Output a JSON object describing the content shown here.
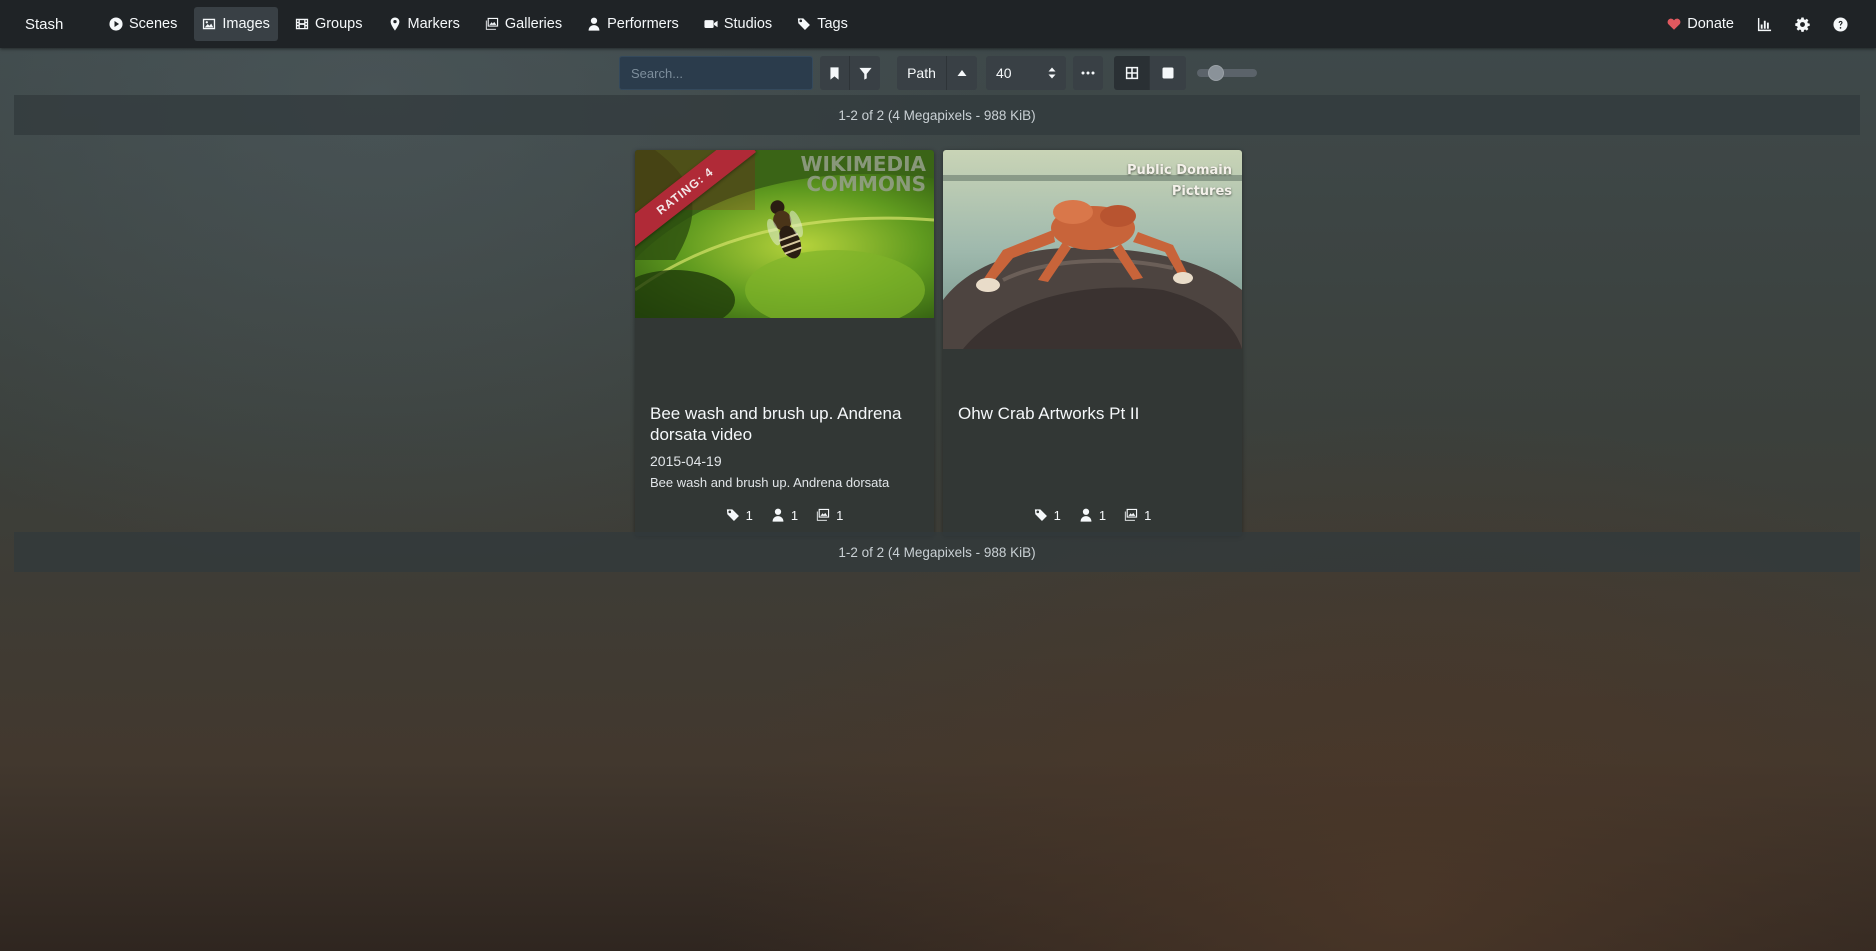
{
  "navbar": {
    "brand": "Stash",
    "items": [
      {
        "label": "Scenes",
        "icon": "play-circle-icon"
      },
      {
        "label": "Images",
        "icon": "image-icon"
      },
      {
        "label": "Groups",
        "icon": "film-icon"
      },
      {
        "label": "Markers",
        "icon": "map-marker-icon"
      },
      {
        "label": "Galleries",
        "icon": "images-icon"
      },
      {
        "label": "Performers",
        "icon": "user-icon"
      },
      {
        "label": "Studios",
        "icon": "video-icon"
      },
      {
        "label": "Tags",
        "icon": "tag-icon"
      }
    ],
    "active": "Images",
    "donate_label": "Donate",
    "right_icons": [
      "heart-icon",
      "chart-icon",
      "gear-icon",
      "help-icon"
    ]
  },
  "toolbar": {
    "search_placeholder": "Search...",
    "sort_by": "Path",
    "sort_direction": "ascending",
    "per_page": "40",
    "display_mode": "grid",
    "zoom_level": 0.25
  },
  "summary": "1-2 of 2 (4 Megapixels - 988 KiB)",
  "cards": [
    {
      "title": "Bee wash and brush up. Andrena dorsata video",
      "date": "2015-04-19",
      "description": "Bee wash and brush up. Andrena dorsata",
      "rating_label": "RATING: 4",
      "watermark_line1": "WIKIMEDIA",
      "watermark_line2": "COMMONS",
      "stats": {
        "tags": "1",
        "performers": "1",
        "galleries": "1"
      }
    },
    {
      "title": "Ohw Crab Artworks Pt II",
      "watermark_line1": "Public Domain",
      "watermark_line2": "Pictures",
      "stats": {
        "tags": "1",
        "performers": "1",
        "galleries": "1"
      }
    }
  ],
  "colors": {
    "navbar_bg": "#1f2326",
    "button_bg": "#394045",
    "card_bg": "#323735",
    "rating_ribbon": "#b02a37",
    "donate_heart": "#e0595f",
    "search_bg": "#2b3c4c"
  }
}
